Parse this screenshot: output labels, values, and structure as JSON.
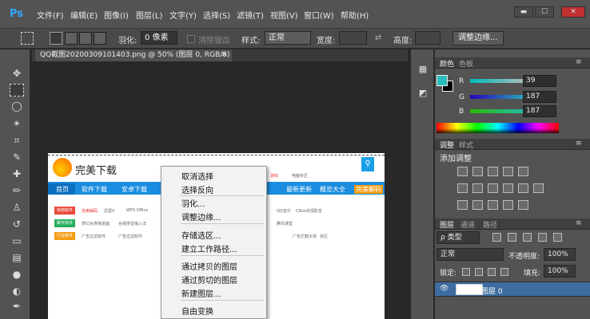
{
  "app": {
    "logo": "Ps"
  },
  "menu": [
    "文件(F)",
    "编辑(E)",
    "图像(I)",
    "图层(L)",
    "文字(Y)",
    "选择(S)",
    "滤镜(T)",
    "视图(V)",
    "窗口(W)",
    "帮助(H)"
  ],
  "window_controls": {
    "minimize": "▬",
    "maximize": "☐",
    "close": "✕"
  },
  "options": {
    "feather_label": "羽化:",
    "feather_value": "0 像素",
    "antialias_label": "消除锯齿",
    "style_label": "样式:",
    "style_value": "正常",
    "width_label": "宽度:",
    "height_label": "高度:",
    "refine_edge_button": "调整边缘..."
  },
  "document_tab": {
    "title": "QQ截图20200309101403.png @ 50% (图层 0, RGB/8)",
    "close": "✕"
  },
  "site": {
    "logo_text": "完美下载",
    "nav": [
      "首页",
      "软件下载",
      "安卓下载",
      "最新更新",
      "概览大全",
      "完美解码"
    ],
    "top_links": [
      "游戏",
      "电脑专区"
    ],
    "categories": [
      "常用软件",
      "聊天软件",
      "行业软件"
    ],
    "texts": [
      "完美解码",
      "迅雷X",
      "WPS Office",
      "QQ音乐",
      "梦幻水族馆桌面",
      "谷歌拼音输入法",
      "腾讯课堂",
      "CBox央视影音",
      "广告过滤软件",
      "广告过滤软件",
      "广告拦截大师",
      "快压"
    ]
  },
  "context_menu": {
    "groups": [
      [
        "取消选择",
        "选择反向"
      ],
      [
        "羽化...",
        "调整边缘..."
      ],
      [
        "存储选区...",
        "建立工作路径..."
      ],
      [
        "通过拷贝的图层",
        "通过剪切的图层",
        "新建图层..."
      ],
      [
        "自由变换"
      ]
    ]
  },
  "color_panel": {
    "tabs": [
      "颜色",
      "色板"
    ],
    "channels": [
      {
        "label": "R",
        "value": "39"
      },
      {
        "label": "G",
        "value": "187"
      },
      {
        "label": "B",
        "value": "187"
      }
    ],
    "foreground": "#27bbbb"
  },
  "adjustments_panel": {
    "tabs": [
      "调整",
      "样式"
    ],
    "add_label": "添加调整"
  },
  "layers_panel": {
    "tabs": [
      "图层",
      "通道",
      "路径"
    ],
    "kind_label": "ρ 类型",
    "blend_mode": "正常",
    "opacity_label": "不透明度:",
    "opacity_value": "100%",
    "lock_label": "锁定:",
    "fill_label": "填充:",
    "fill_value": "100%",
    "layer_name": "图层 0"
  }
}
